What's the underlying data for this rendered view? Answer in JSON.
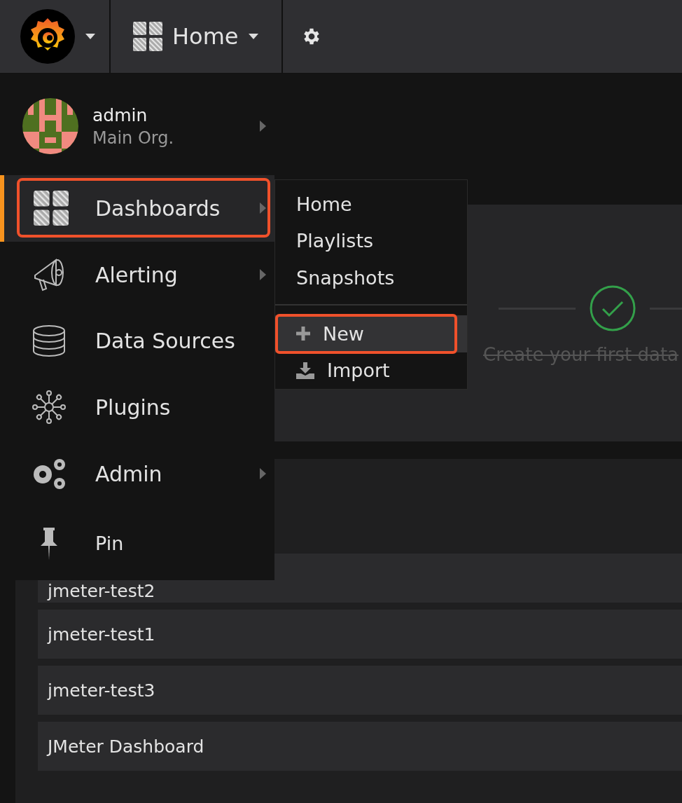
{
  "topbar": {
    "dashboard_title": "Home"
  },
  "user": {
    "name": "admin",
    "org": "Main Org."
  },
  "sidebar": {
    "items": [
      {
        "label": "Dashboards",
        "selected": true,
        "has_submenu": true,
        "annotated": true
      },
      {
        "label": "Alerting",
        "selected": false,
        "has_submenu": true,
        "annotated": false
      },
      {
        "label": "Data Sources",
        "selected": false,
        "has_submenu": false,
        "annotated": false
      },
      {
        "label": "Plugins",
        "selected": false,
        "has_submenu": false,
        "annotated": false
      },
      {
        "label": "Admin",
        "selected": false,
        "has_submenu": true,
        "annotated": false
      },
      {
        "label": "Pin",
        "selected": false,
        "has_submenu": false,
        "annotated": false
      }
    ]
  },
  "submenu": {
    "sections": [
      [
        {
          "label": "Home",
          "selected": false,
          "annotated": false
        },
        {
          "label": "Playlists",
          "selected": false,
          "annotated": false
        },
        {
          "label": "Snapshots",
          "selected": false,
          "annotated": false
        }
      ],
      [
        {
          "label": "New",
          "selected": true,
          "annotated": true
        },
        {
          "label": "Import",
          "selected": false,
          "annotated": false
        }
      ]
    ]
  },
  "progress": {
    "step": {
      "label": "Create your first data",
      "done": true
    }
  },
  "recent_dashboards": [
    {
      "title": "jmeter-test2"
    },
    {
      "title": "jmeter-test1"
    },
    {
      "title": "jmeter-test3"
    },
    {
      "title": "JMeter Dashboard"
    }
  ]
}
